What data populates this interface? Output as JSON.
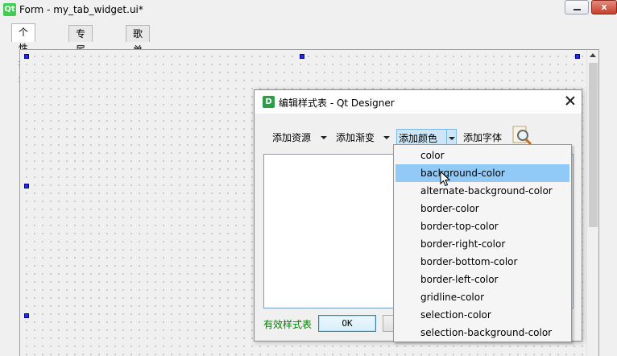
{
  "form_window": {
    "logo_text": "Qt",
    "title": "Form - my_tab_widget.ui*",
    "close_glyph": "x"
  },
  "tabs": [
    {
      "label": "个性推荐",
      "active": true
    },
    {
      "label": "专属定制",
      "active": false
    },
    {
      "label": "歌单",
      "active": false
    }
  ],
  "dialog": {
    "icon_text": "D",
    "title": "编辑样式表 - Qt Designer",
    "toolbar": {
      "add_resource": "添加资源",
      "add_gradient": "添加渐变",
      "add_color": "添加颜色",
      "add_font": "添加字体"
    },
    "editor_value": "",
    "status_text": "有效样式表",
    "status_color": "#008000",
    "ok_label": "OK"
  },
  "color_menu": {
    "hovered_index": 1,
    "items": [
      "color",
      "background-color",
      "alternate-background-color",
      "border-color",
      "border-top-color",
      "border-right-color",
      "border-bottom-color",
      "border-left-color",
      "gridline-color",
      "selection-color",
      "selection-background-color"
    ]
  },
  "colors": {
    "menu_highlight": "#91c9f7",
    "qt_green": "#41cd52",
    "handle_blue": "#2b2bd6"
  }
}
